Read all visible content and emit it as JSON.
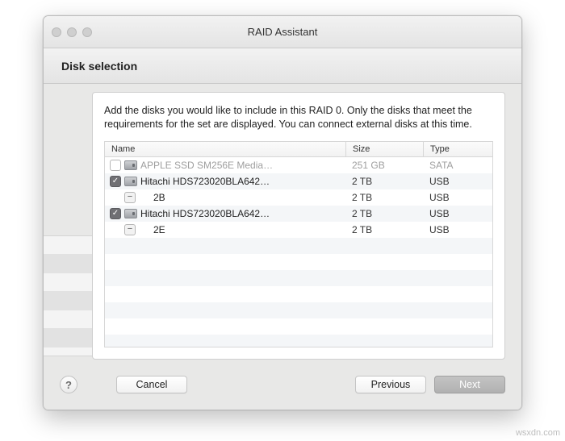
{
  "window": {
    "title": "RAID Assistant"
  },
  "header": {
    "section_title": "Disk selection"
  },
  "panel": {
    "instructions": "Add the disks you would like to include in this RAID 0. Only the disks that meet the requirements for the set are displayed. You can connect external disks at this time."
  },
  "table": {
    "columns": {
      "name": "Name",
      "size": "Size",
      "type": "Type"
    },
    "rows": [
      {
        "indent": 0,
        "checkbox": "unchecked",
        "icon": "disk",
        "name": "APPLE SSD SM256E Media…",
        "size": "251 GB",
        "type": "SATA",
        "dim": true
      },
      {
        "indent": 0,
        "checkbox": "checked",
        "icon": "disk",
        "name": "Hitachi HDS723020BLA642…",
        "size": "2 TB",
        "type": "USB",
        "dim": false
      },
      {
        "indent": 1,
        "checkbox": "mixed",
        "icon": "none",
        "name": "2B",
        "size": "2 TB",
        "type": "USB",
        "dim": false
      },
      {
        "indent": 0,
        "checkbox": "checked",
        "icon": "disk",
        "name": "Hitachi HDS723020BLA642…",
        "size": "2 TB",
        "type": "USB",
        "dim": false
      },
      {
        "indent": 1,
        "checkbox": "mixed",
        "icon": "none",
        "name": "2E",
        "size": "2 TB",
        "type": "USB",
        "dim": false
      }
    ]
  },
  "footer": {
    "help_label": "?",
    "cancel": "Cancel",
    "previous": "Previous",
    "next": "Next"
  },
  "watermark": "wsxdn.com"
}
